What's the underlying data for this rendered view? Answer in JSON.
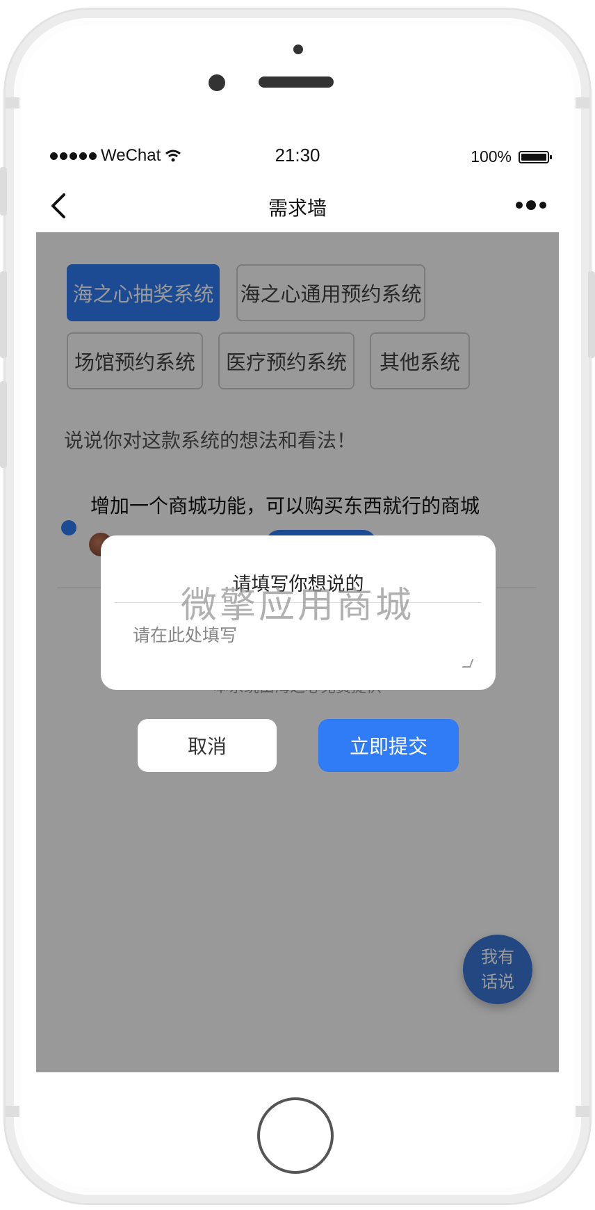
{
  "status_bar": {
    "carrier": "WeChat",
    "time": "21:30",
    "battery": "100%"
  },
  "nav": {
    "title": "需求墙"
  },
  "tags": [
    {
      "label": "海之心抽奖系统",
      "active": true
    },
    {
      "label": "海之心通用预约系统",
      "active": false
    },
    {
      "label": "场馆预约系统",
      "active": false
    },
    {
      "label": "医疗预约系统",
      "active": false
    },
    {
      "label": "其他系统",
      "active": false
    }
  ],
  "prompt": "说说你对这款系统的想法和看法！",
  "entry": {
    "text": "增加一个商城功能，可以购买东西就行的商城"
  },
  "footer_note": "本系统由海之心免费提供",
  "fab": {
    "line1": "我有",
    "line2": "话说"
  },
  "modal": {
    "title": "请填写你想说的",
    "placeholder": "请在此处填写",
    "cancel_label": "取消",
    "submit_label": "立即提交"
  },
  "watermark": "微擎应用商城",
  "colors": {
    "accent": "#2f7cf6",
    "overlay": "rgba(0,0,0,0.4)"
  }
}
